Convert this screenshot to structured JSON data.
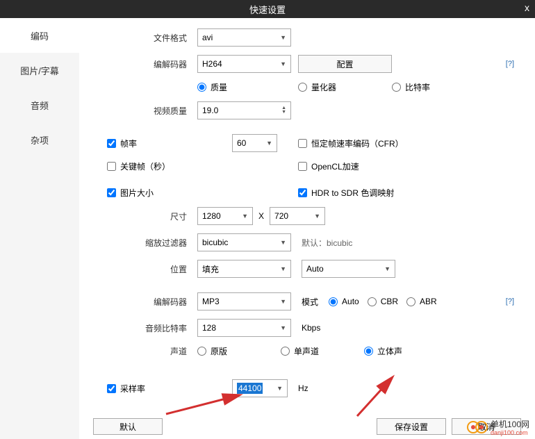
{
  "titlebar": {
    "title": "快速设置",
    "close": "x"
  },
  "sidebar": {
    "tabs": [
      {
        "label": "编码",
        "active": true
      },
      {
        "label": "图片/字幕",
        "active": false
      },
      {
        "label": "音频",
        "active": false
      },
      {
        "label": "杂项",
        "active": false
      }
    ]
  },
  "fileFormat": {
    "label": "文件格式",
    "value": "avi"
  },
  "codec": {
    "label": "编解码器",
    "value": "H264",
    "configBtn": "配置",
    "help": "[?]"
  },
  "codecMode": {
    "quality": "质量",
    "quantizer": "量化器",
    "bitrate": "比特率"
  },
  "videoQuality": {
    "label": "视频质量",
    "value": "19.0"
  },
  "frameRate": {
    "label": "帧率",
    "value": "60",
    "cfr": "恒定帧速率编码（CFR）"
  },
  "keyframe": {
    "label": "关键帧（秒）",
    "opencl": "OpenCL加速"
  },
  "imageSize": {
    "label": "图片大小",
    "hdr": "HDR to SDR 色调映射"
  },
  "size": {
    "label": "尺寸",
    "width": "1280",
    "height": "720",
    "x": "X"
  },
  "scaleFilter": {
    "label": "缩放过滤器",
    "value": "bicubic",
    "default": "默认：bicubic"
  },
  "position": {
    "label": "位置",
    "value": "填充",
    "auto": "Auto"
  },
  "audioCodec": {
    "label": "编解码器",
    "value": "MP3",
    "modeLabel": "模式",
    "auto": "Auto",
    "cbr": "CBR",
    "abr": "ABR",
    "help": "[?]"
  },
  "audioBitrate": {
    "label": "音频比特率",
    "value": "128",
    "unit": "Kbps"
  },
  "channel": {
    "label": "声道",
    "original": "原版",
    "mono": "单声道",
    "stereo": "立体声"
  },
  "sampleRate": {
    "label": "采样率",
    "value": "44100",
    "unit": "Hz"
  },
  "footer": {
    "default": "默认",
    "save": "保存设置",
    "cancel": "取消"
  },
  "watermark": {
    "name": "单机100网",
    "url": "danji100.com"
  }
}
